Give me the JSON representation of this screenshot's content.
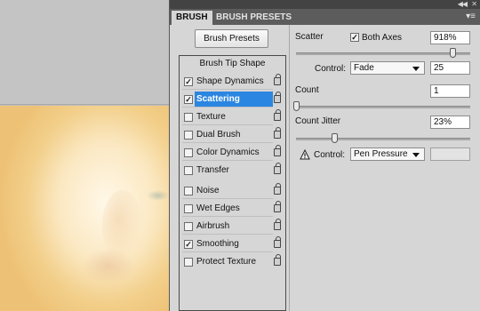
{
  "panel": {
    "tabs": [
      "BRUSH",
      "BRUSH PRESETS"
    ],
    "brush_presets_button": "Brush Presets",
    "brush_tip_shape": "Brush Tip Shape",
    "options": [
      {
        "label": "Shape Dynamics",
        "checked": true,
        "selected": false
      },
      {
        "label": "Scattering",
        "checked": true,
        "selected": true
      },
      {
        "label": "Texture",
        "checked": false,
        "selected": false
      },
      {
        "label": "Dual Brush",
        "checked": false,
        "selected": false
      },
      {
        "label": "Color Dynamics",
        "checked": false,
        "selected": false
      },
      {
        "label": "Transfer",
        "checked": false,
        "selected": false
      },
      {
        "label": "Noise",
        "checked": false,
        "selected": false
      },
      {
        "label": "Wet Edges",
        "checked": false,
        "selected": false
      },
      {
        "label": "Airbrush",
        "checked": false,
        "selected": false
      },
      {
        "label": "Smoothing",
        "checked": true,
        "selected": false
      },
      {
        "label": "Protect Texture",
        "checked": false,
        "selected": false
      }
    ],
    "scatter": {
      "label": "Scatter",
      "both_axes_label": "Both Axes",
      "both_axes_checked": true,
      "value": "918%",
      "slider_fraction": 0.93
    },
    "control1": {
      "label": "Control:",
      "selected": "Fade",
      "value": "25"
    },
    "count": {
      "label": "Count",
      "value": "1",
      "slider_fraction": 0.0
    },
    "count_jitter": {
      "label": "Count Jitter",
      "value": "23%",
      "slider_fraction": 0.23
    },
    "control2": {
      "label": "Control:",
      "selected": "Pen Pressure"
    },
    "checkmark_glyph": "✓"
  }
}
